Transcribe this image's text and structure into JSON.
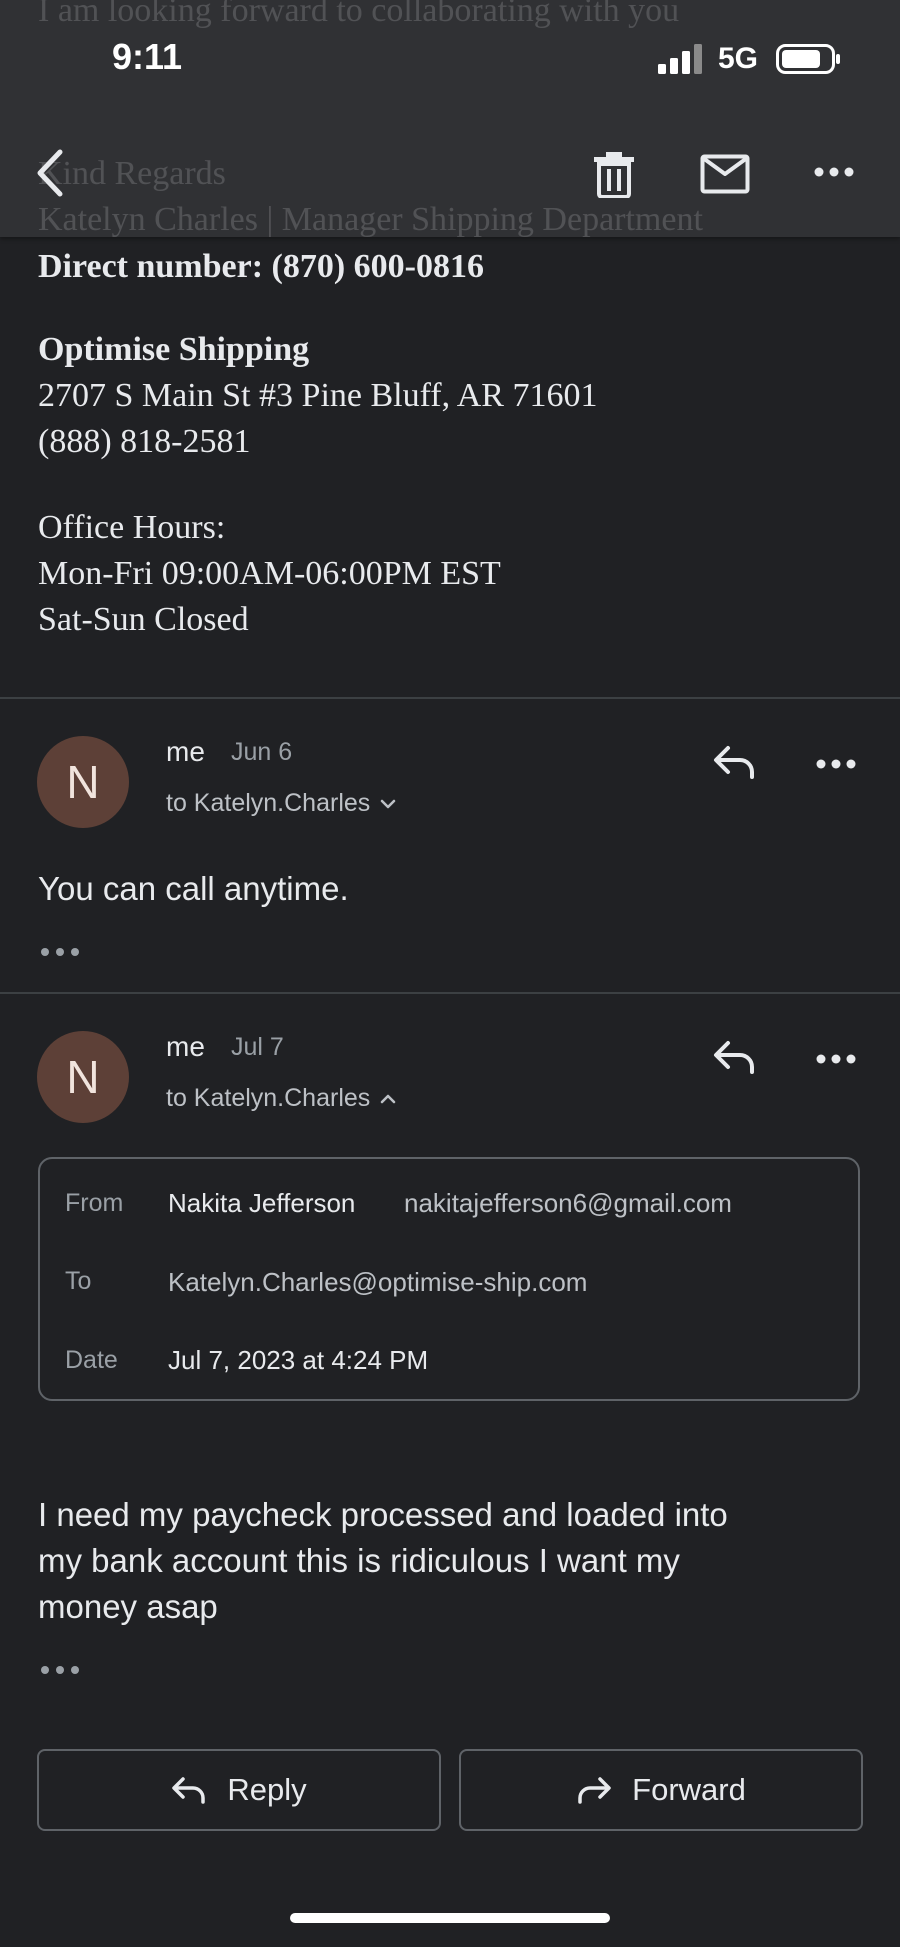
{
  "status_bar": {
    "time": "9:11",
    "network": "5G"
  },
  "background_peek": {
    "line1": "I am looking forward to collaborating with you",
    "line2": "Kind Regards",
    "line3": "Katelyn Charles | Manager Shipping Department"
  },
  "signature": {
    "direct_number": "Direct number: (870) 600-0816",
    "company": "Optimise Shipping",
    "address": "2707 S Main St #3 Pine Bluff, AR 71601",
    "phone": "(888) 818-2581",
    "hours_label": "Office Hours:",
    "hours_weekday": "Mon-Fri 09:00AM-06:00PM EST",
    "hours_weekend": "Sat-Sun Closed"
  },
  "messages": [
    {
      "avatar_letter": "N",
      "sender": "me",
      "date": "Jun 6",
      "to": "to Katelyn.Charles",
      "body": "You can call anytime."
    },
    {
      "avatar_letter": "N",
      "sender": "me",
      "date": "Jul 7",
      "to": "to Katelyn.Charles",
      "details": {
        "from_label": "From",
        "from_name": "Nakita Jefferson",
        "from_email": "nakitajefferson6@gmail.com",
        "to_label": "To",
        "to_value": "Katelyn.Charles@optimise-ship.com",
        "date_label": "Date",
        "date_value": "Jul 7, 2023 at 4:24 PM"
      },
      "body_lines": [
        "I need my paycheck processed and loaded into",
        "my bank account this is ridiculous I want my",
        "money asap"
      ]
    }
  ],
  "actions": {
    "reply": "Reply",
    "forward": "Forward"
  },
  "icons": {
    "back": "back-arrow-icon",
    "delete": "trash-icon",
    "mark_unread": "mail-icon",
    "more": "more-horizontal-icon",
    "reply": "reply-icon",
    "forward": "forward-icon"
  },
  "colors": {
    "background": "#202124",
    "toolbar": "#303134",
    "avatar": "#5d4037",
    "text": "#e8eaed",
    "secondary_text": "#9aa0a6"
  }
}
